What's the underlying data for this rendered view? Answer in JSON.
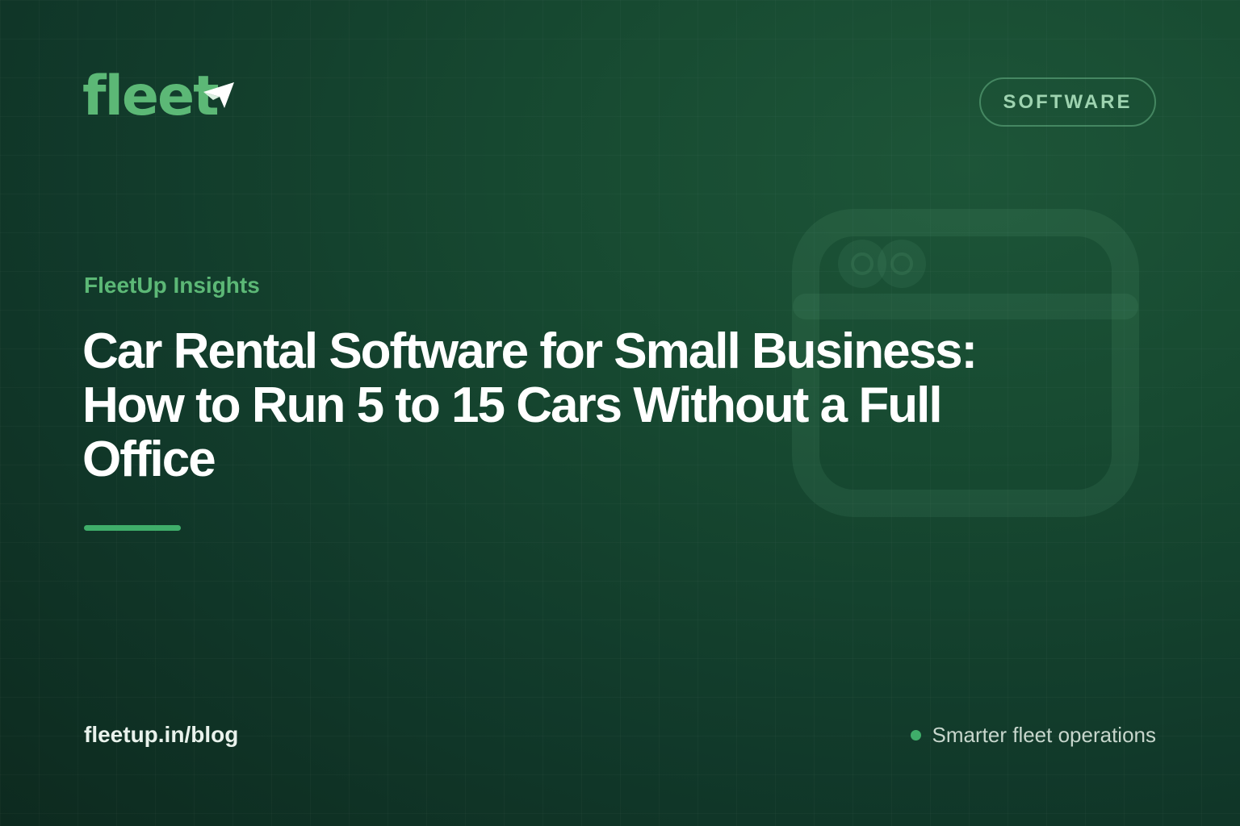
{
  "brand": {
    "logo_text": "fleet",
    "accent_color": "#5cb876"
  },
  "category": {
    "label": "SOFTWARE"
  },
  "background_icon": {
    "name": "browser-window-icon"
  },
  "article": {
    "eyebrow": "FleetUp Insights",
    "title": "Car Rental Software for Small Business: How to Run 5 to 15 Cars Without a Full Office"
  },
  "footer": {
    "url": "fleetup.in/blog",
    "tagline": "Smarter fleet operations"
  },
  "colors": {
    "background": "#174a31",
    "accent_bar": "#3fae6a",
    "title": "#ffffff"
  }
}
